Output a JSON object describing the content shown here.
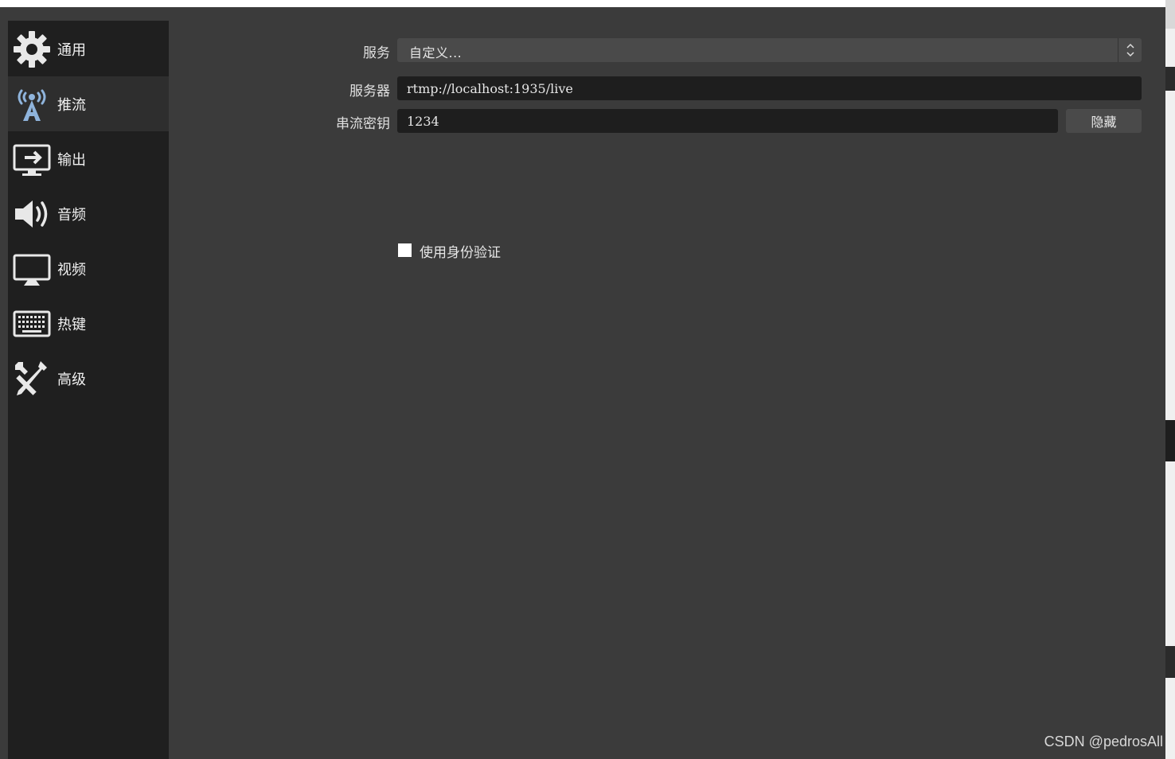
{
  "sidebar": {
    "items": [
      {
        "label": "通用",
        "icon": "gear-icon"
      },
      {
        "label": "推流",
        "icon": "broadcast-tower-icon",
        "active": true
      },
      {
        "label": "输出",
        "icon": "monitor-output-icon"
      },
      {
        "label": "音频",
        "icon": "speaker-icon"
      },
      {
        "label": "视频",
        "icon": "monitor-icon"
      },
      {
        "label": "热键",
        "icon": "keyboard-icon"
      },
      {
        "label": "高级",
        "icon": "tools-icon"
      }
    ]
  },
  "stream": {
    "service_label": "服务",
    "service_value": "自定义...",
    "server_label": "服务器",
    "server_value": "rtmp://localhost:1935/live",
    "key_label": "串流密钥",
    "key_value": "1234",
    "hide_button": "隐藏",
    "auth_label": "使用身份验证",
    "auth_checked": false
  },
  "watermark": "CSDN @pedrosAll",
  "colors": {
    "background": "#3b3b3b",
    "sidebar": "#1f1f1f",
    "active_item": "#2e2e2e",
    "input_bg": "#1e1e1e",
    "button_bg": "#4a4a4a",
    "accent_icon": "#8fb4dc"
  }
}
